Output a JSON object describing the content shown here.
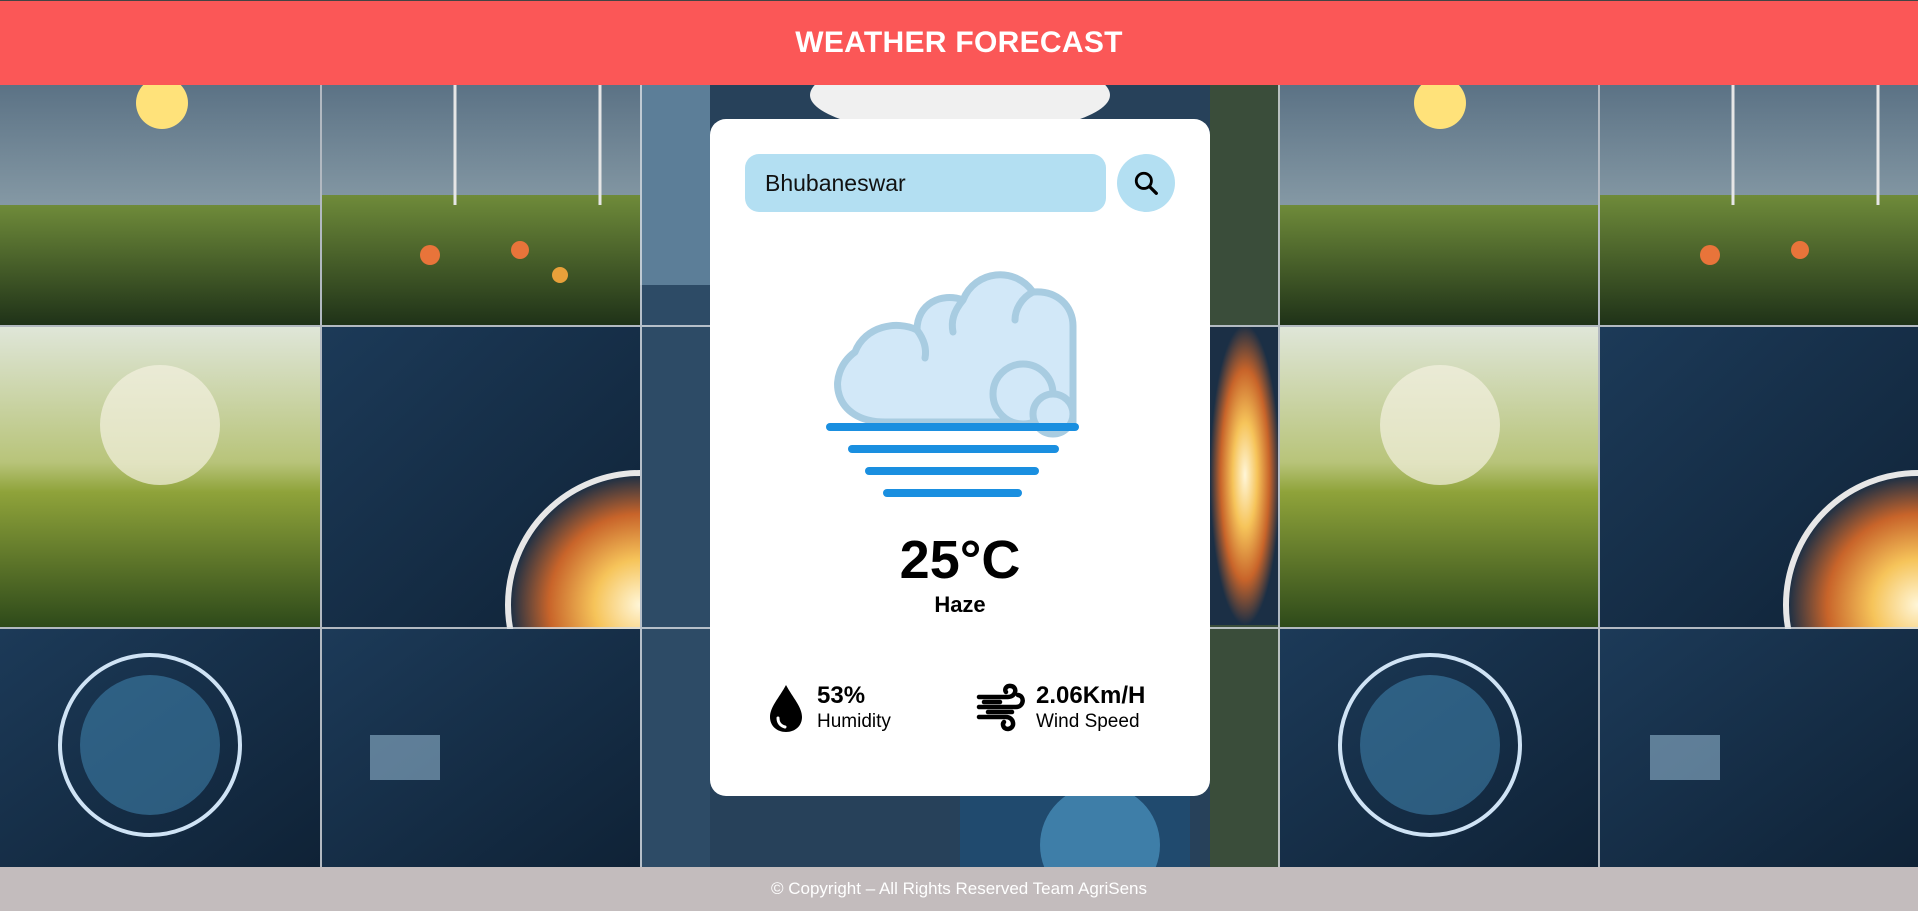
{
  "header": {
    "title": "WEATHER FORECAST"
  },
  "search": {
    "value": "Bhubaneswar",
    "placeholder": "Enter city name",
    "button_icon": "search-icon"
  },
  "weather": {
    "temperature": "25°C",
    "condition": "Haze",
    "icon": "haze-cloud-icon"
  },
  "stats": {
    "humidity": {
      "value": "53%",
      "label": "Humidity",
      "icon": "water-drop-icon"
    },
    "wind": {
      "value": "2.06Km/H",
      "label": "Wind Speed",
      "icon": "wind-icon"
    }
  },
  "footer": {
    "text": "© Copyright – All Rights Reserved Team AgriSens"
  },
  "colors": {
    "header_bg": "#fb5757",
    "footer_bg": "#c3bcbd",
    "input_bg": "#b3dff2",
    "cloud_fill": "#d2e8f8",
    "cloud_stroke": "#a8cce1",
    "haze_lines": "#1a8fe0"
  }
}
